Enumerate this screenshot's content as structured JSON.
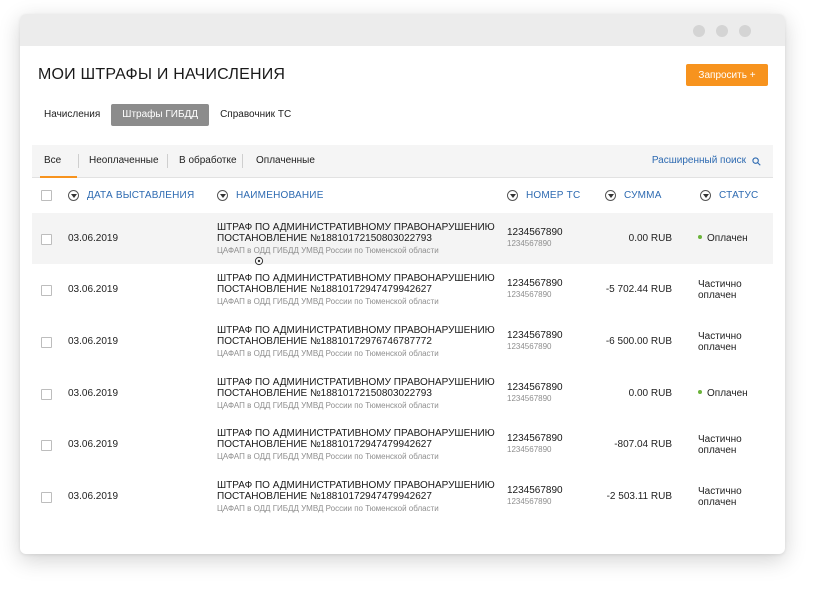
{
  "header": {
    "title": "МОИ ШТРАФЫ И НАЧИСЛЕНИЯ",
    "request_button": "Запросить +"
  },
  "subtabs": [
    {
      "label": "Начисления",
      "active": false
    },
    {
      "label": "Штрафы ГИБДД",
      "active": true
    },
    {
      "label": "Справочник ТС",
      "active": false
    }
  ],
  "filters": {
    "tabs": [
      {
        "label": "Все",
        "active": true
      },
      {
        "label": "Неоплаченные",
        "active": false
      },
      {
        "label": "В обработке",
        "active": false
      },
      {
        "label": "Оплаченные",
        "active": false
      }
    ],
    "advanced_search": "Расширенный поиск"
  },
  "table": {
    "columns": {
      "date": "ДАТА ВЫСТАВЛЕНИЯ",
      "name": "НАИМЕНОВАНИЕ",
      "plate": "НОМЕР ТС",
      "sum": "СУММА",
      "status": "СТАТУС"
    },
    "rows": [
      {
        "date": "03.06.2019",
        "line1": "ШТРАФ ПО АДМИНИСТРАТИВНОМУ ПРАВОНАРУШЕНИЮ",
        "line2": "ПОСТАНОВЛЕНИЕ №18810172150803022793",
        "org": "ЦАФАП в ОДД ГИБДД УМВД России по Тюменской области",
        "plate": "1234567890",
        "plate_sub": "1234567890",
        "sum": "0.00 RUB",
        "status": "Оплачен",
        "status_l1": "",
        "status_l2": ""
      },
      {
        "date": "03.06.2019",
        "line1": "ШТРАФ ПО АДМИНИСТРАТИВНОМУ ПРАВОНАРУШЕНИЮ",
        "line2": "ПОСТАНОВЛЕНИЕ №18810172947479942627",
        "org": "ЦАФАП в ОДД ГИБДД УМВД России по Тюменской области",
        "plate": "1234567890",
        "plate_sub": "1234567890",
        "sum": "-5 702.44 RUB",
        "status": "",
        "status_l1": "Частично",
        "status_l2": "оплачен"
      },
      {
        "date": "03.06.2019",
        "line1": "ШТРАФ ПО АДМИНИСТРАТИВНОМУ ПРАВОНАРУШЕНИЮ",
        "line2": "ПОСТАНОВЛЕНИЕ №18810172976746787772",
        "org": "ЦАФАП в ОДД ГИБДД УМВД России по Тюменской области",
        "plate": "1234567890",
        "plate_sub": "1234567890",
        "sum": "-6 500.00 RUB",
        "status": "",
        "status_l1": "Частично",
        "status_l2": "оплачен"
      },
      {
        "date": "03.06.2019",
        "line1": "ШТРАФ ПО АДМИНИСТРАТИВНОМУ ПРАВОНАРУШЕНИЮ",
        "line2": "ПОСТАНОВЛЕНИЕ №18810172150803022793",
        "org": "ЦАФАП в ОДД ГИБДД УМВД России по Тюменской области",
        "plate": "1234567890",
        "plate_sub": "1234567890",
        "sum": "0.00 RUB",
        "status": "Оплачен",
        "status_l1": "",
        "status_l2": ""
      },
      {
        "date": "03.06.2019",
        "line1": "ШТРАФ ПО АДМИНИСТРАТИВНОМУ ПРАВОНАРУШЕНИЮ",
        "line2": "ПОСТАНОВЛЕНИЕ №18810172947479942627",
        "org": "ЦАФАП в ОДД ГИБДД УМВД России по Тюменской области",
        "plate": "1234567890",
        "plate_sub": "1234567890",
        "sum": "-807.04 RUB",
        "status": "",
        "status_l1": "Частично",
        "status_l2": "оплачен"
      },
      {
        "date": "03.06.2019",
        "line1": "ШТРАФ ПО АДМИНИСТРАТИВНОМУ ПРАВОНАРУШЕНИЮ",
        "line2": "ПОСТАНОВЛЕНИЕ №18810172947479942627",
        "org": "ЦАФАП в ОДД ГИБДД УМВД России по Тюменской области",
        "plate": "1234567890",
        "plate_sub": "1234567890",
        "sum": "-2 503.11 RUB",
        "status": "",
        "status_l1": "Частично",
        "status_l2": "оплачен"
      }
    ]
  },
  "colors": {
    "accent": "#f7931e",
    "link": "#2d6ab1",
    "paid_dot": "#6bb33a",
    "active_subtab": "#8c8c8c"
  }
}
